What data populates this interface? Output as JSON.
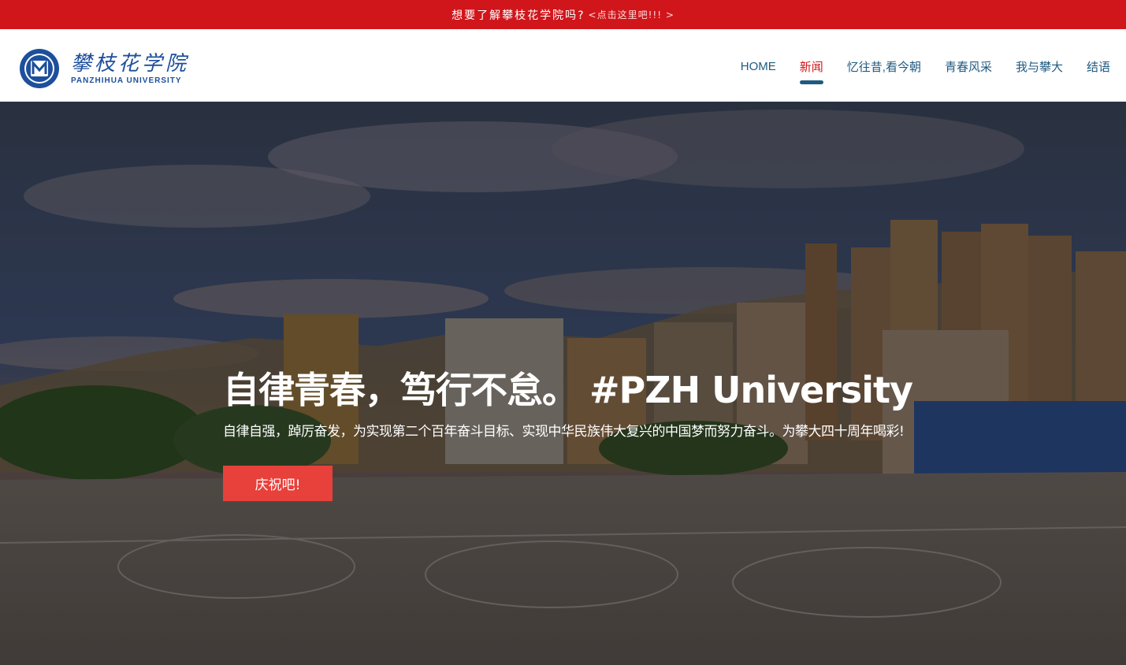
{
  "announcement": {
    "text": "想要了解攀枝花学院吗?",
    "link": "<点击这里吧!!! >"
  },
  "brand": {
    "name_cn": "攀枝花学院",
    "name_en": "PANZHIHUA UNIVERSITY",
    "color": "#1d4f9c"
  },
  "nav": {
    "items": [
      {
        "label": "HOME"
      },
      {
        "label": "新闻"
      },
      {
        "label": "忆往昔,看今朝"
      },
      {
        "label": "青春风采"
      },
      {
        "label": "我与攀大"
      },
      {
        "label": "结语"
      }
    ],
    "active_index": 1
  },
  "hero": {
    "title": "自律青春，笃行不怠。 #PZH University",
    "subtitle": "自律自强，踔厉奋发，为实现第二个百年奋斗目标、实现中华民族伟大复兴的中国梦而努力奋斗。为攀大四十周年喝彩!",
    "button_label": "庆祝吧!"
  },
  "colors": {
    "topbar": "#d0161b",
    "nav_text": "#1f5a80",
    "nav_active": "#d0161b",
    "cta": "#e8403a"
  }
}
